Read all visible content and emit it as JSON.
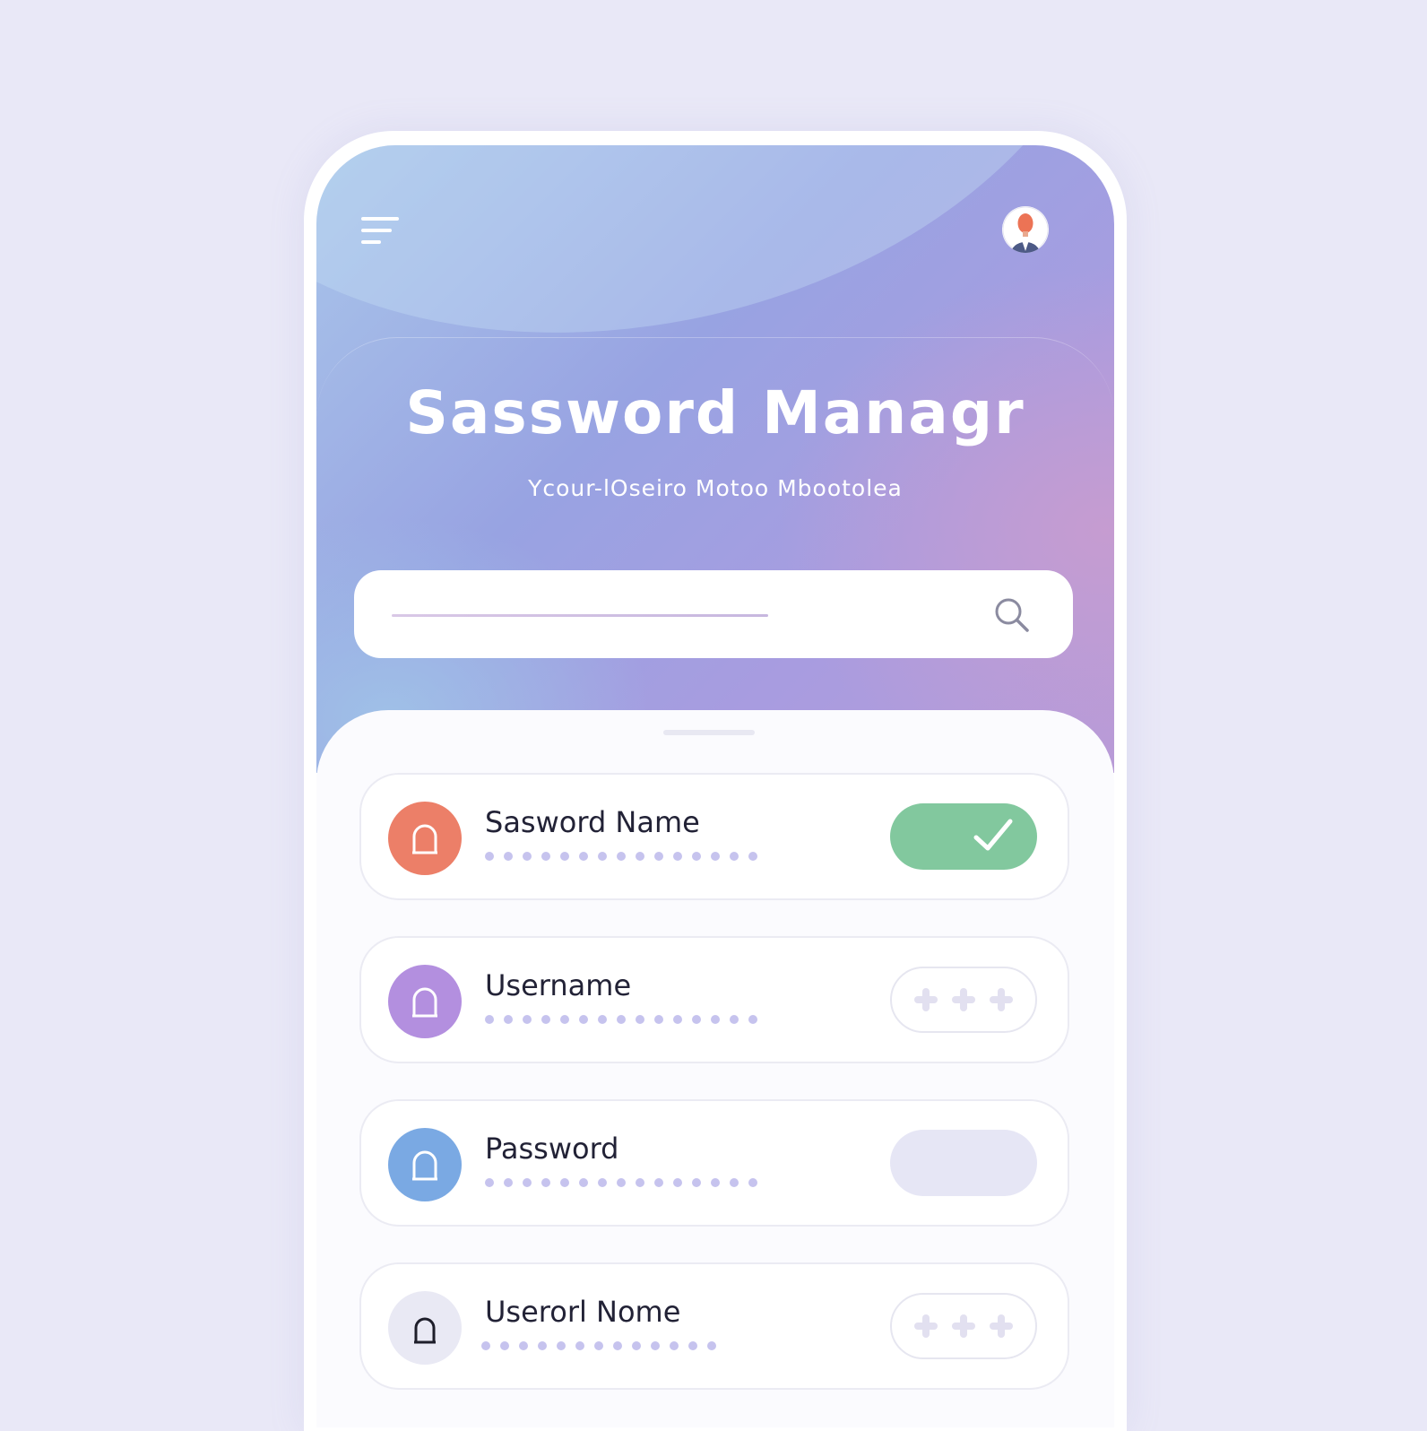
{
  "header": {
    "title": "Sassword Managr",
    "subtitle": "Ycour-lOseiro Motoo Mbootolea"
  },
  "search": {
    "placeholder": "",
    "icon": "search-icon"
  },
  "items": [
    {
      "label": "Sasword Name",
      "dots": 15,
      "icon_color": "#ec7f68",
      "icon": "lock-icon",
      "action": "check",
      "action_color": "#82c89e"
    },
    {
      "label": "Username",
      "dots": 15,
      "icon_color": "#b38fdf",
      "icon": "lock-icon",
      "action": "more"
    },
    {
      "label": "Password",
      "dots": 15,
      "icon_color": "#7aa9e3",
      "icon": "lock-icon",
      "action": "empty"
    },
    {
      "label": "Userorl Nome",
      "dots": 13,
      "icon_color": "#e9e9f4",
      "icon": "lock-icon",
      "action": "more"
    }
  ],
  "colors": {
    "background": "#e9e8f7",
    "accent_green": "#82c89e",
    "dot": "#c6c3ee"
  }
}
